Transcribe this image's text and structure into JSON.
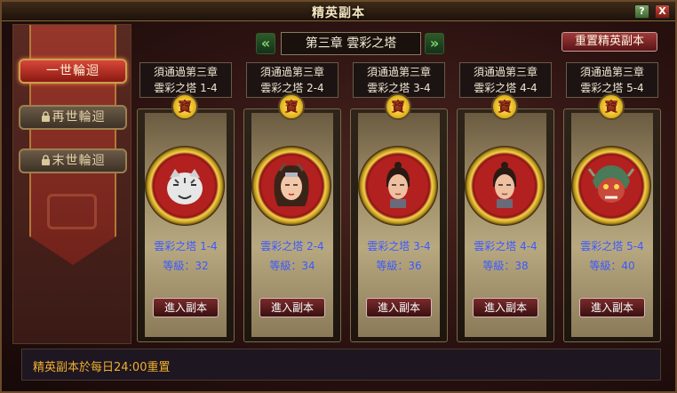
{
  "window": {
    "title": "精英副本",
    "help_label": "?",
    "close_label": "X"
  },
  "sidebar": {
    "tabs": [
      {
        "label": "一世輪迴",
        "state": "active"
      },
      {
        "label": "再世輪迴",
        "state": "locked"
      },
      {
        "label": "末世輪迴",
        "state": "locked"
      }
    ]
  },
  "chapter": {
    "prev_label": "«",
    "next_label": "»",
    "label": "第三章 雲彩之塔"
  },
  "reset_button": "重置精英副本",
  "cards": [
    {
      "req_line1": "須通過第三章",
      "req_line2": "雲彩之塔 1-4",
      "medal": "寶",
      "name": "雲彩之塔 1-4",
      "level": "等級：32",
      "enter": "進入副本",
      "portrait": "white-tiger-icon"
    },
    {
      "req_line1": "須通過第三章",
      "req_line2": "雲彩之塔 2-4",
      "medal": "寶",
      "name": "雲彩之塔 2-4",
      "level": "等級：34",
      "enter": "進入副本",
      "portrait": "female-warrior-icon"
    },
    {
      "req_line1": "須通過第三章",
      "req_line2": "雲彩之塔 3-4",
      "medal": "寶",
      "name": "雲彩之塔 3-4",
      "level": "等級：36",
      "enter": "進入副本",
      "portrait": "young-man-icon"
    },
    {
      "req_line1": "須通過第三章",
      "req_line2": "雲彩之塔 4-4",
      "medal": "寶",
      "name": "雲彩之塔 4-4",
      "level": "等級：38",
      "enter": "進入副本",
      "portrait": "young-man-icon"
    },
    {
      "req_line1": "須通過第三章",
      "req_line2": "雲彩之塔 5-4",
      "medal": "寶",
      "name": "雲彩之塔 5-4",
      "level": "等級：40",
      "enter": "進入副本",
      "portrait": "armored-beast-icon"
    }
  ],
  "footer": {
    "note": "精英副本於每日24:00重置"
  },
  "colors": {
    "accent_gold": "#f0b030",
    "link_blue": "#3a5aff",
    "active_tab_red": "#d8463a",
    "nav_green": "#7ed86a"
  }
}
